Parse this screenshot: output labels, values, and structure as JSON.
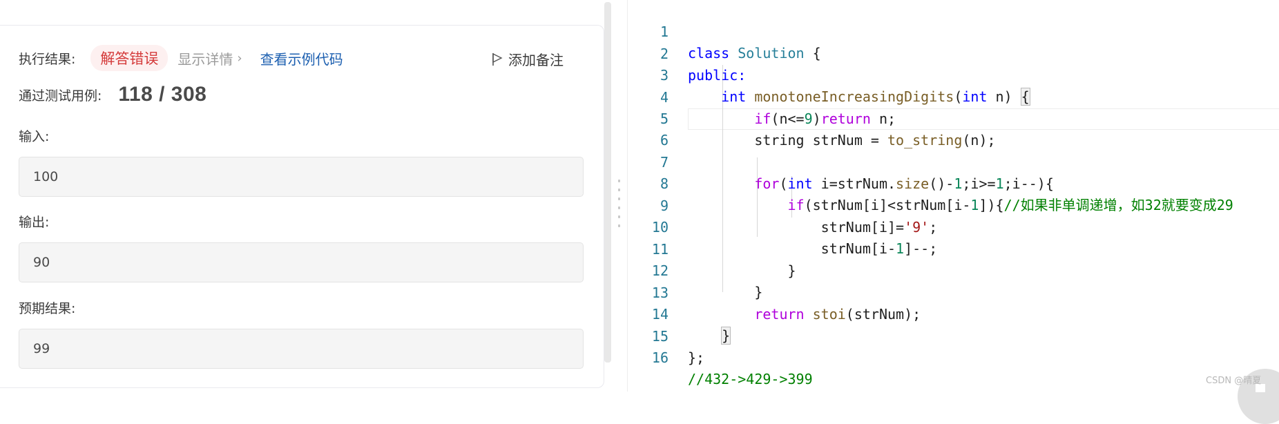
{
  "result": {
    "label": "执行结果:",
    "status": "解答错误",
    "detail": "显示详情",
    "detail_chevron": "›",
    "example": "查看示例代码",
    "note": "添加备注"
  },
  "tests": {
    "label": "通过测试用例:",
    "count": "118 / 308"
  },
  "input": {
    "label": "输入:",
    "value": "100"
  },
  "output": {
    "label": "输出:",
    "value": "90"
  },
  "expected": {
    "label": "预期结果:",
    "value": "99"
  },
  "editor": {
    "line_numbers": [
      "1",
      "2",
      "3",
      "4",
      "5",
      "6",
      "7",
      "8",
      "9",
      "10",
      "11",
      "12",
      "13",
      "14",
      "15",
      "16"
    ],
    "tokens": {
      "class": "class",
      "solution": "Solution",
      "brace_open": " {",
      "public": "public:",
      "int": "int",
      "func": "monotoneIncreasingDigits",
      "paren_open": "(",
      "int2": "int",
      "param": " n) ",
      "brace3": "{",
      "if": "if",
      "cond4a": "(n<=",
      "nine": "9",
      "cond4b": ")",
      "return": "return",
      "ret4": " n;",
      "string_decl": "string strNum = ",
      "to_string": "to_string",
      "args5": "(n);",
      "for": "for",
      "for_a": "(",
      "for_int": "int",
      "for_b": " i=strNum.",
      "size": "size",
      "for_c": "()-",
      "one_a": "1",
      "for_d": ";i>=",
      "one_b": "1",
      "for_e": ";i--){",
      "if8": "if",
      "cond8a": "(strNum[i]<strNum[i-",
      "one_c": "1",
      "cond8b": "]){",
      "comment8": "//如果非单调递增，如32就要变成29",
      "assign9a": "strNum[i]=",
      "char9": "'9'",
      "assign9b": ";",
      "dec10a": "strNum[i-",
      "one_d": "1",
      "dec10b": "]--;",
      "close11": "}",
      "close12": "}",
      "return13": "return",
      "stoi": "stoi",
      "args13": "(strNum);",
      "close14": "}",
      "close15": "};",
      "comment16": "//432->429->399"
    }
  },
  "watermark": "CSDN @晴夏",
  "colors": {
    "keyword": "#0000ff",
    "control": "#af00db",
    "function": "#795e26",
    "class": "#267f99",
    "number": "#098658",
    "string": "#a31515",
    "comment": "#008000",
    "error": "#d43a3a",
    "link": "#1c5fb0"
  }
}
